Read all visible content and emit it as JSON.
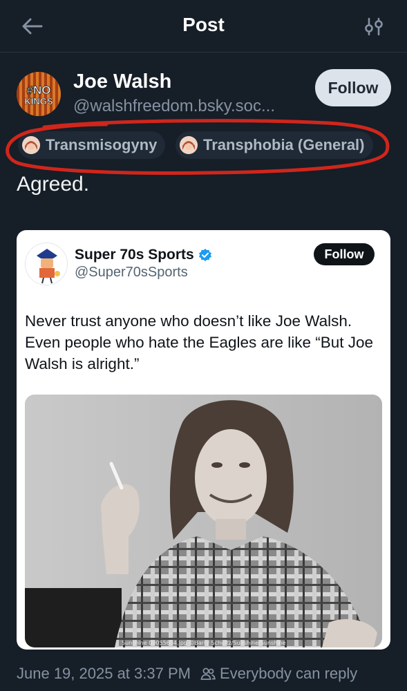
{
  "header": {
    "title": "Post",
    "back_icon": "arrow-left-icon",
    "settings_icon": "sliders-icon"
  },
  "author": {
    "name": "Joe Walsh",
    "handle": "@walshfreedom.bsky.soc...",
    "avatar_text_top": "#NO",
    "avatar_text_bottom": "KINGS",
    "follow_label": "Follow"
  },
  "labels": [
    {
      "text": "Transmisogyny"
    },
    {
      "text": "Transphobia (General)"
    }
  ],
  "post": {
    "text": "Agreed."
  },
  "embed": {
    "name": "Super 70s Sports",
    "handle": "@Super70sSports",
    "follow_label": "Follow",
    "text": "Never trust anyone who doesn’t like Joe Walsh. Even people who hate the Eagles are like “But Joe Walsh is alright.”",
    "photo_credit": "Sunshine 00055684.jpg ©Barry Schultz/Sunshine/Sunshine"
  },
  "footer": {
    "timestamp": "June 19, 2025 at 3:37 PM",
    "reply_setting": "Everybody can reply"
  },
  "colors": {
    "background": "#161e27",
    "highlight_circle": "#d0261c",
    "verified": "#1d9bf0"
  }
}
